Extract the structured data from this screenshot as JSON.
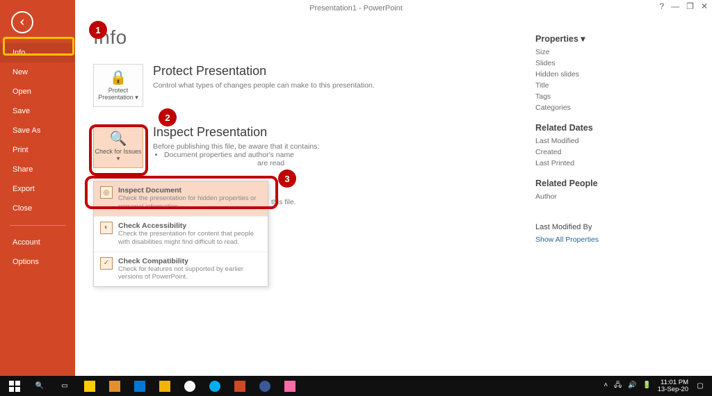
{
  "app": {
    "title": "Presentation1 - PowerPoint"
  },
  "win": {
    "help": "?",
    "min": "—",
    "max": "❐",
    "close": "✕"
  },
  "sidebar": {
    "items": [
      {
        "label": "Info"
      },
      {
        "label": "New"
      },
      {
        "label": "Open"
      },
      {
        "label": "Save"
      },
      {
        "label": "Save As"
      },
      {
        "label": "Print"
      },
      {
        "label": "Share"
      },
      {
        "label": "Export"
      },
      {
        "label": "Close"
      }
    ],
    "bottom": [
      {
        "label": "Account"
      },
      {
        "label": "Options"
      }
    ]
  },
  "page": {
    "title": "Info",
    "protect": {
      "button": "Protect Presentation ▾",
      "heading": "Protect Presentation",
      "desc": "Control what types of changes people can make to this presentation."
    },
    "inspect": {
      "button": "Check for Issues ▾",
      "heading": "Inspect Presentation",
      "intro": "Before publishing this file, be aware that it contains:",
      "bullets": [
        "Document properties and author's name"
      ],
      "trail": "are                             read",
      "trail2": "this file."
    },
    "dropdown": [
      {
        "title": "Inspect Document",
        "sub": "Check the presentation for hidden properties or personal information."
      },
      {
        "title": "Check Accessibility",
        "sub": "Check the presentation for content that people with disabilities might find difficult to read."
      },
      {
        "title": "Check Compatibility",
        "sub": "Check for features not supported by earlier versions of PowerPoint."
      }
    ]
  },
  "props": {
    "head1": "Properties ▾",
    "list1": [
      "Size",
      "Slides",
      "Hidden slides",
      "Title",
      "Tags",
      "Categories"
    ],
    "head2": "Related Dates",
    "list2": [
      "Last Modified",
      "Created",
      "Last Printed"
    ],
    "head3": "Related People",
    "list3": [
      "Author"
    ],
    "head4": "Last Modified By",
    "link": "Show All Properties"
  },
  "badges": {
    "b1": "1",
    "b2": "2",
    "b3": "3"
  },
  "taskbar": {
    "clock_time": "11:01 PM",
    "clock_date": "13-Sep-20"
  }
}
